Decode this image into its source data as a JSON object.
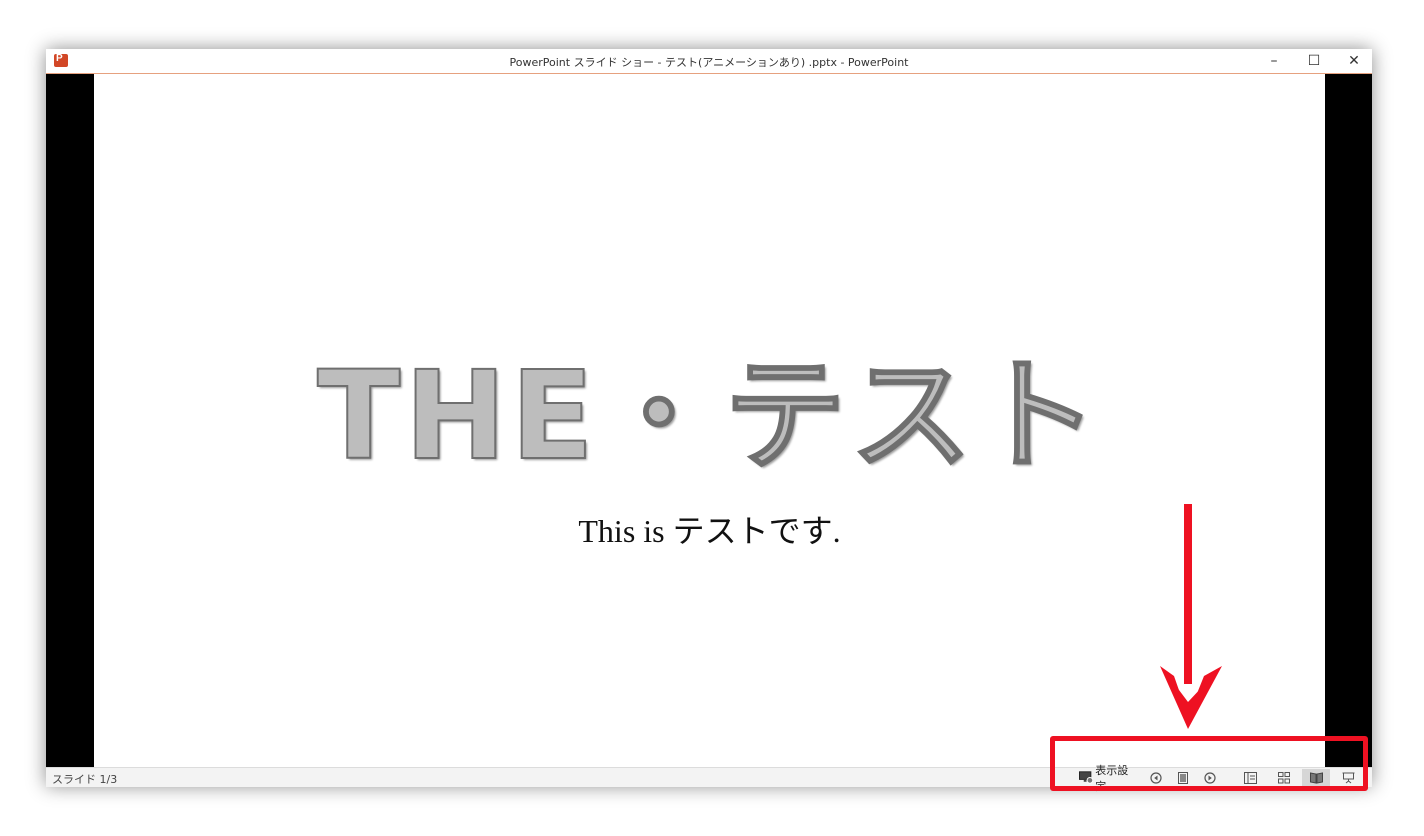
{
  "window": {
    "title": "PowerPoint スライド ショー  -  テスト(アニメーションあり) .pptx - PowerPoint",
    "minimize_glyph": "–",
    "maximize_glyph": "☐",
    "close_glyph": "✕"
  },
  "slide": {
    "title": "THE・テスト",
    "subtitle": "This is テストです."
  },
  "statusbar": {
    "slide_counter": "スライド 1/3",
    "display_settings_label": "表示設定",
    "icons": [
      "display-settings-icon",
      "previous-icon",
      "slide-panel-icon",
      "next-icon",
      "normal-view-icon",
      "slide-sorter-icon",
      "reading-view-icon",
      "slide-show-icon"
    ],
    "active_view": "reading-view"
  },
  "annotation": {
    "color": "#ee1122"
  }
}
